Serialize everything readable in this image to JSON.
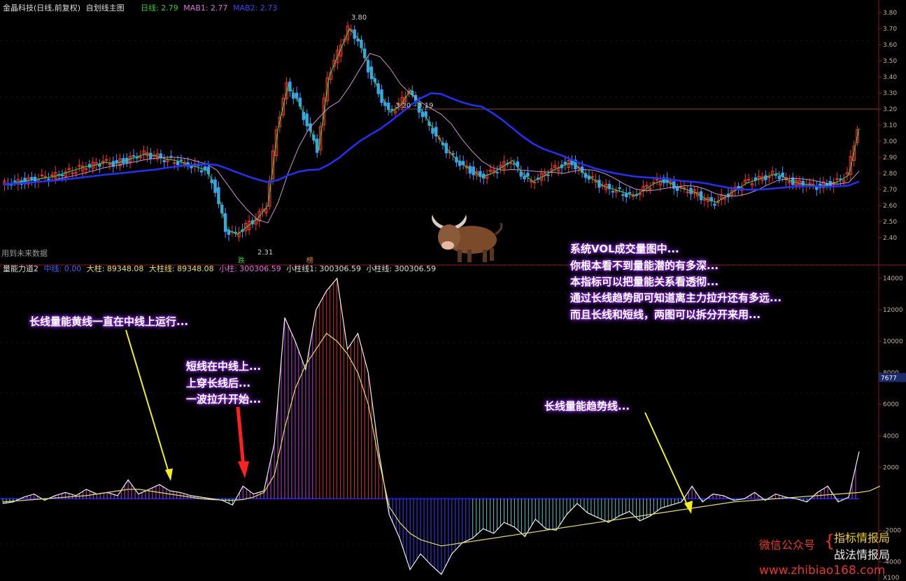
{
  "top_header": {
    "stock_name": "金晶科技(日线,前复权)",
    "indicator_name": "自划线主图",
    "daily_line": "日线: 2.79",
    "mab1": "MAB1: 2.77",
    "mab2": "MAB2: 2.73"
  },
  "bottom_header": {
    "indicator_name": "量能力道2",
    "mid_line": "中线: 0.00",
    "big_bar": "大柱: 89348.08",
    "big_bar_line": "大柱线: 89348.08",
    "small_bar": "小柱: 300306.59",
    "small_bar_line1": "小柱线1: 300306.59",
    "small_bar_line": "小柱线: 300306.59"
  },
  "top_notes": {
    "future_data": "用到未来数据",
    "high_label": "3.80",
    "low_label": "2.31",
    "range_label": "3.20 - 3.19",
    "tag_fall": "跌",
    "tag_rise": "榜"
  },
  "annotations": {
    "long_line_yellow": "长线量能黄线一直在中线上运行...",
    "short_line": [
      "短线在中线上...",
      "上穿长线后...",
      "一波拉升开始..."
    ],
    "trend_line": "长线量能趋势线...",
    "system_vol": [
      "系统VOL成交量图中...",
      "你根本看不到量能潜的有多深...",
      "本指标可以把量能关系看透彻...",
      "通过长线趋势即可知道离主力拉升还有多远...",
      "而且长线和短线，两图可以拆分开来用..."
    ]
  },
  "watermark": {
    "wechat": "微信公众号",
    "name1": "指标情报局",
    "name2": "战法情报局",
    "site": "www.zhibiao168.com"
  },
  "axis": {
    "price_ticks": [
      "3.80",
      "3.70",
      "3.60",
      "3.50",
      "3.40",
      "3.30",
      "3.20",
      "3.10",
      "3.00",
      "2.90",
      "2.80",
      "2.70",
      "2.60",
      "2.50",
      "2.40"
    ],
    "vol_ticks": [
      "14000",
      "12000",
      "10000",
      "8000",
      "6000",
      "4000",
      "2000",
      "-2000",
      "-4000"
    ],
    "vol_marker": "7677",
    "vol_unit": "X100"
  },
  "chart_data": [
    {
      "type": "candlestick",
      "title": "自划线主图",
      "ylim": [
        2.35,
        3.85
      ],
      "series_names": [
        "日线",
        "MAB1",
        "MAB2"
      ],
      "close_path": [
        2.73,
        2.74,
        2.75,
        2.76,
        2.77,
        2.78,
        2.8,
        2.82,
        2.84,
        2.85,
        2.87,
        2.86,
        2.88,
        2.9,
        2.92,
        2.91,
        2.89,
        2.88,
        2.86,
        2.84,
        2.82,
        2.7,
        2.45,
        2.42,
        2.47,
        2.52,
        2.6,
        3.08,
        3.35,
        3.25,
        3.1,
        2.95,
        3.4,
        3.55,
        3.7,
        3.63,
        3.45,
        3.3,
        3.18,
        3.22,
        3.32,
        3.2,
        3.1,
        3.0,
        2.92,
        2.86,
        2.82,
        2.78,
        2.8,
        2.84,
        2.88,
        2.8,
        2.75,
        2.78,
        2.82,
        2.85,
        2.87,
        2.8,
        2.76,
        2.72,
        2.7,
        2.68,
        2.66,
        2.7,
        2.74,
        2.76,
        2.72,
        2.7,
        2.68,
        2.64,
        2.62,
        2.66,
        2.7,
        2.74,
        2.76,
        2.78,
        2.8,
        2.76,
        2.74,
        2.73,
        2.72,
        2.73,
        2.75,
        2.79,
        3.08
      ],
      "annotations": {
        "high": 3.8,
        "low": 2.31,
        "ref_line": 3.2
      }
    },
    {
      "type": "histogram",
      "title": "量能力道2",
      "ylim": [
        -5000,
        14500
      ],
      "short_line": [
        -300,
        -200,
        100,
        300,
        -100,
        200,
        400,
        200,
        600,
        300,
        400,
        200,
        1200,
        300,
        600,
        900,
        500,
        400,
        200,
        100,
        0,
        -100,
        -400,
        800,
        300,
        500,
        3500,
        11500,
        10000,
        8200,
        12000,
        13200,
        14000,
        9500,
        10500,
        8000,
        3000,
        -1000,
        -2500,
        -4500,
        -3500,
        -4200,
        -4800,
        -3500,
        -2800,
        -2500,
        -1900,
        -2200,
        -1500,
        -1800,
        -2400,
        -1300,
        -1900,
        -2000,
        -1000,
        -300,
        -900,
        -1200,
        -1500,
        -1100,
        -800,
        -1400,
        -1100,
        -600,
        -400,
        -200,
        800,
        -200,
        300,
        200,
        -100,
        0,
        400,
        -100,
        300,
        100,
        0,
        -200,
        400,
        800,
        -200,
        100,
        3000
      ],
      "long_line": [
        -200,
        -150,
        -100,
        -50,
        0,
        50,
        100,
        150,
        200,
        300,
        400,
        500,
        600,
        600,
        500,
        400,
        300,
        200,
        100,
        0,
        -50,
        -80,
        -100,
        -50,
        100,
        400,
        1500,
        4500,
        7000,
        8500,
        9500,
        10500,
        10000,
        9200,
        8000,
        6000,
        2500,
        -500,
        -1500,
        -2200,
        -2600,
        -2800,
        -3000,
        -2900,
        -2800,
        -2700,
        -2600,
        -2500,
        -2400,
        -2300,
        -2200,
        -2100,
        -2000,
        -1900,
        -1800,
        -1700,
        -1600,
        -1500,
        -1400,
        -1300,
        -1200,
        -1100,
        -1000,
        -900,
        -800,
        -700,
        -600,
        -500,
        -400,
        -300,
        -200,
        -150,
        -100,
        -50,
        0,
        50,
        100,
        150,
        200,
        250,
        300,
        350,
        400,
        500,
        800
      ]
    }
  ]
}
